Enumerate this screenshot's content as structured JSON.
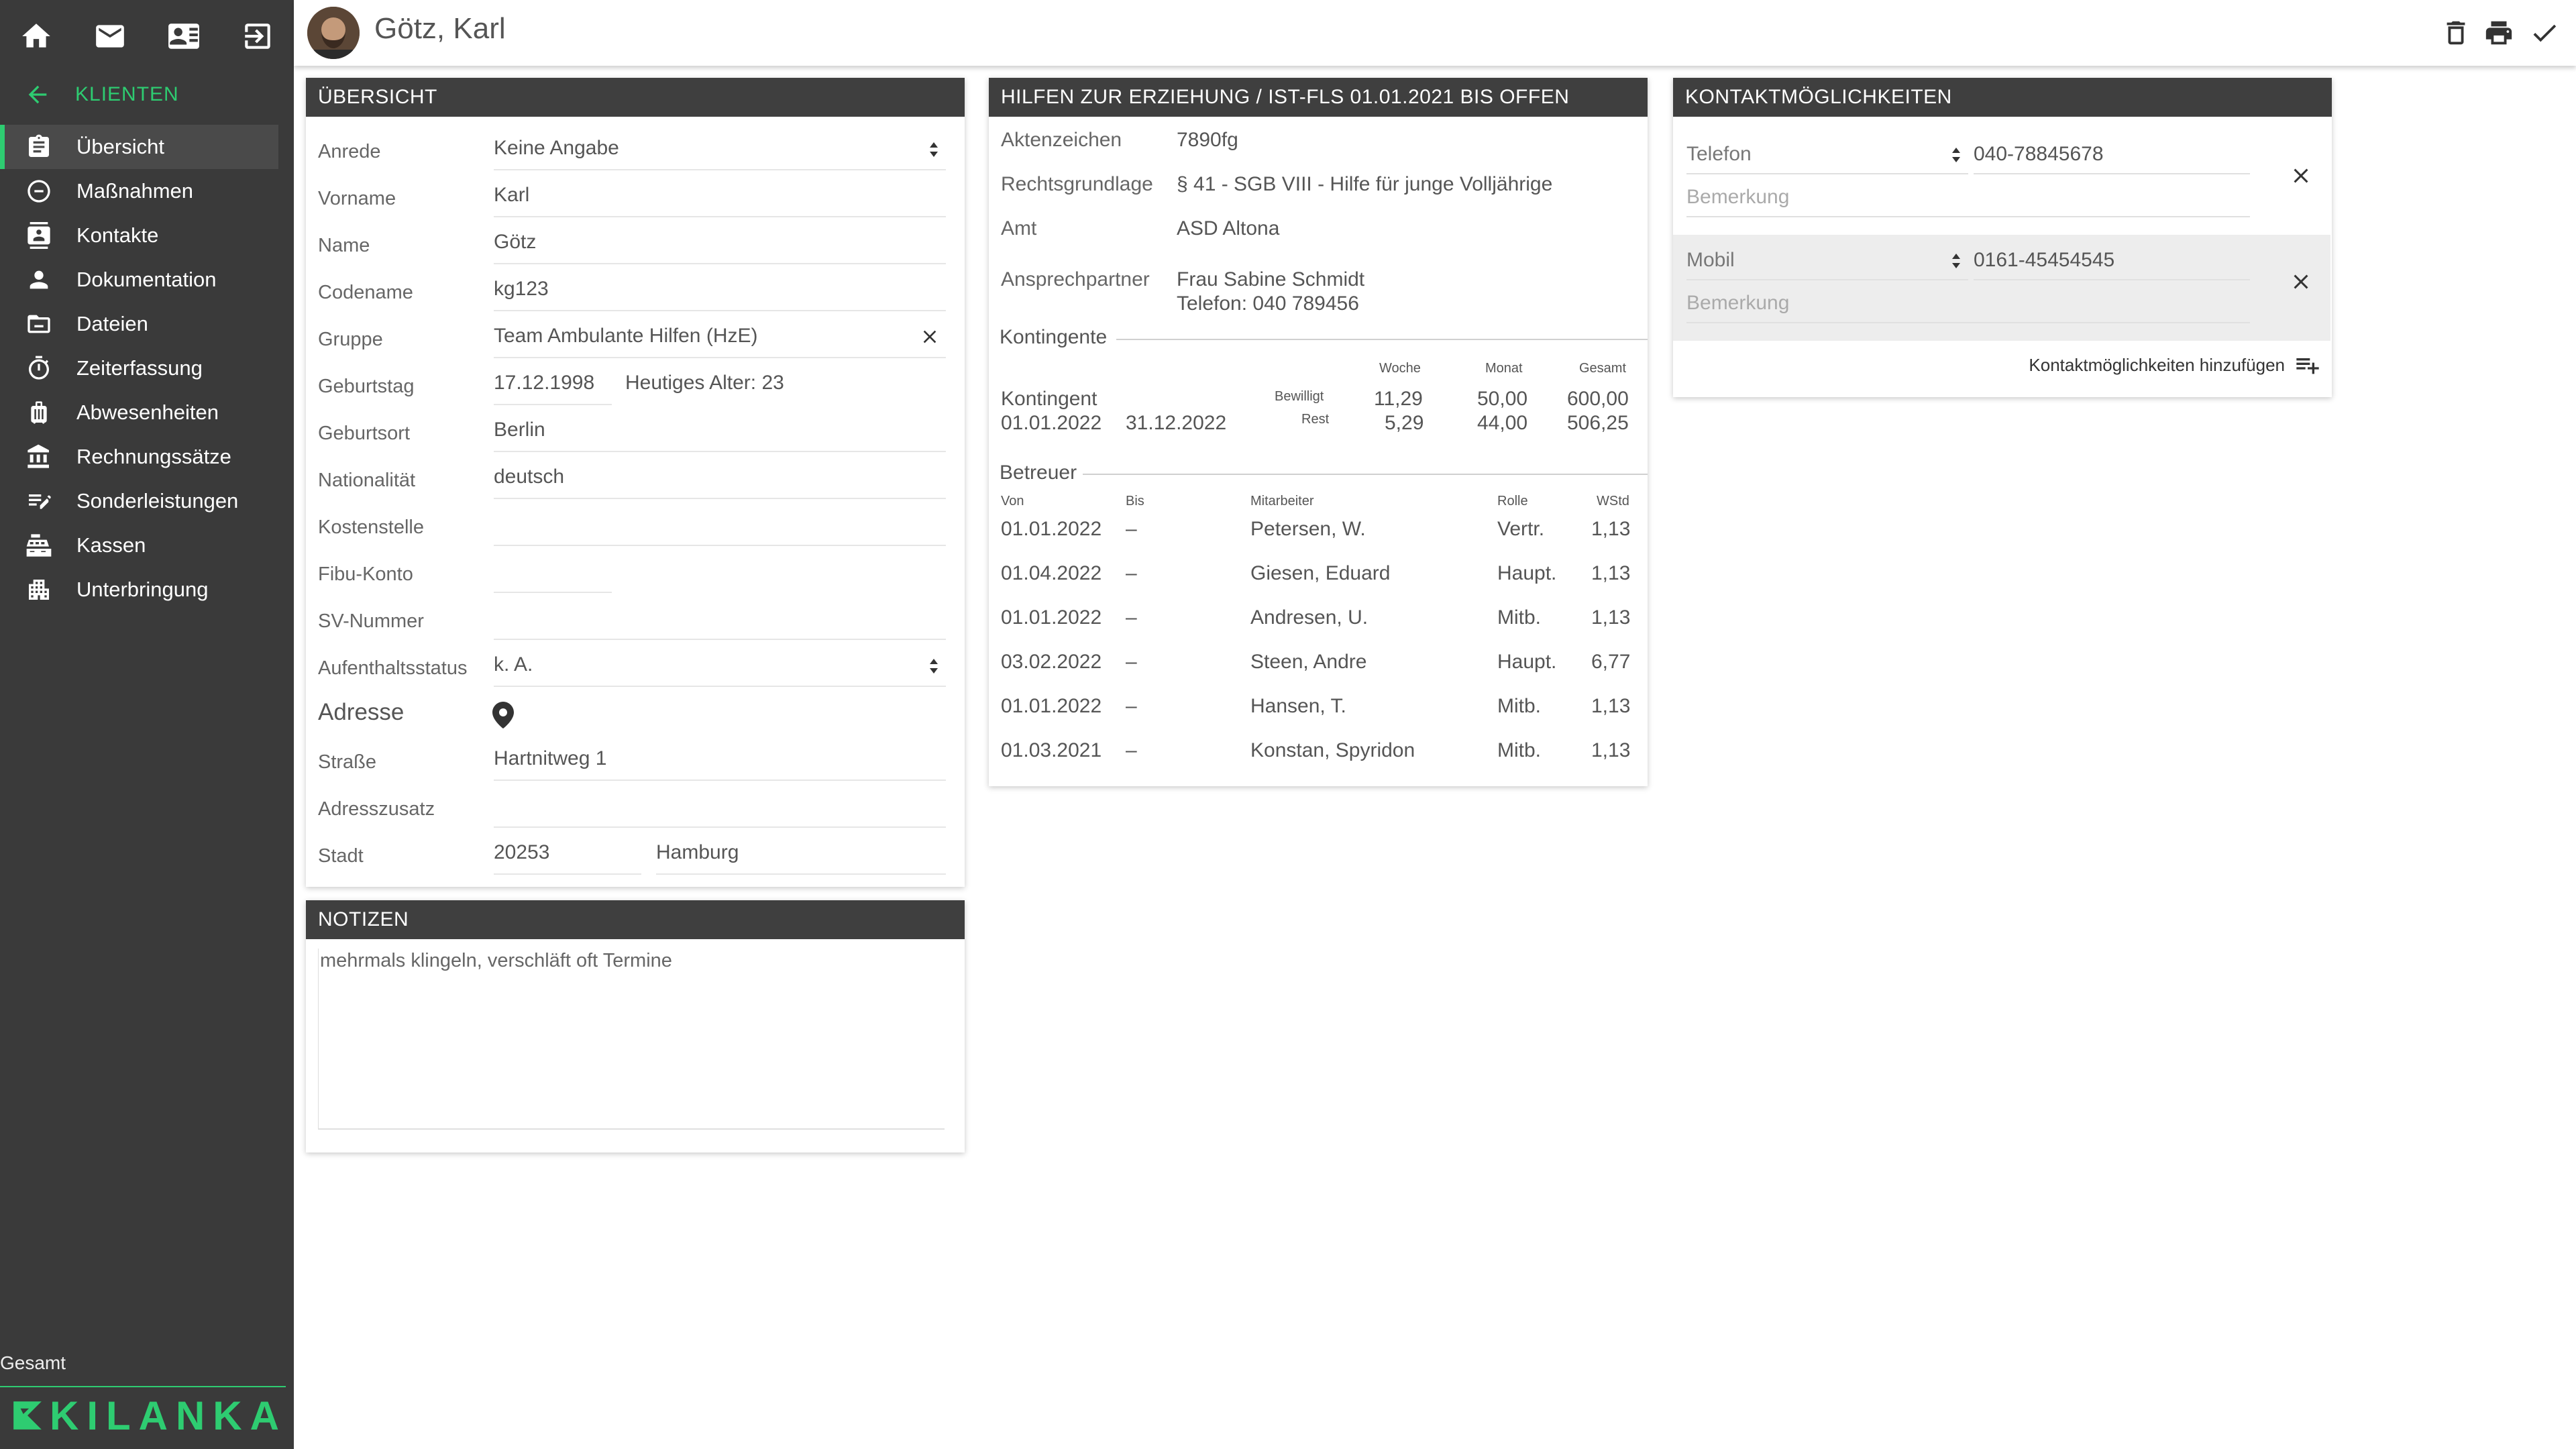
{
  "app": {
    "brand": "KILANKA"
  },
  "colors": {
    "accent": "#2ecc71",
    "sidebar": "#3a3a3a",
    "header": "#3f3f3f"
  },
  "sidebar": {
    "top_icons": [
      "home-icon",
      "mail-icon",
      "contact-card-icon",
      "logout-icon"
    ],
    "back_label": "KLIENTEN",
    "items": [
      {
        "label": "Übersicht",
        "icon": "overview-icon",
        "active": true
      },
      {
        "label": "Maßnahmen",
        "icon": "measures-icon"
      },
      {
        "label": "Kontakte",
        "icon": "contacts-icon"
      },
      {
        "label": "Dokumentation",
        "icon": "person-icon"
      },
      {
        "label": "Dateien",
        "icon": "folder-icon"
      },
      {
        "label": "Zeiterfassung",
        "icon": "stopwatch-icon"
      },
      {
        "label": "Abwesenheiten",
        "icon": "suitcase-icon"
      },
      {
        "label": "Rechnungssätze",
        "icon": "bank-icon"
      },
      {
        "label": "Sonderleistungen",
        "icon": "edit-list-icon"
      },
      {
        "label": "Kassen",
        "icon": "cash-register-icon"
      },
      {
        "label": "Unterbringung",
        "icon": "housing-icon"
      }
    ],
    "footer_label": "Gesamt"
  },
  "header": {
    "client_name": "Götz, Karl",
    "actions": [
      "delete-icon",
      "print-icon",
      "check-icon"
    ]
  },
  "overview": {
    "title": "ÜBERSICHT",
    "anrede": {
      "label": "Anrede",
      "value": "Keine Angabe"
    },
    "vorname": {
      "label": "Vorname",
      "value": "Karl"
    },
    "name": {
      "label": "Name",
      "value": "Götz"
    },
    "codename": {
      "label": "Codename",
      "value": "kg123"
    },
    "gruppe": {
      "label": "Gruppe",
      "value": "Team Ambulante Hilfen (HzE)"
    },
    "geburtstag": {
      "label": "Geburtstag",
      "value": "17.12.1998",
      "age": "Heutiges Alter: 23"
    },
    "geburtsort": {
      "label": "Geburtsort",
      "value": "Berlin"
    },
    "nationalitaet": {
      "label": "Nationalität",
      "value": "deutsch"
    },
    "kostenstelle": {
      "label": "Kostenstelle",
      "value": ""
    },
    "fibu": {
      "label": "Fibu-Konto",
      "value": ""
    },
    "sv": {
      "label": "SV-Nummer",
      "value": ""
    },
    "aufenthalt": {
      "label": "Aufenthaltsstatus",
      "value": "k. A."
    },
    "adresse_label": "Adresse",
    "strasse": {
      "label": "Straße",
      "value": "Hartnitweg 1"
    },
    "adresszusatz": {
      "label": "Adresszusatz",
      "value": ""
    },
    "stadt": {
      "label": "Stadt",
      "plz": "20253",
      "city": "Hamburg"
    }
  },
  "notes": {
    "title": "NOTIZEN",
    "text": "mehrmals klingeln, verschläft oft Termine"
  },
  "hilfen": {
    "title": "HILFEN ZUR ERZIEHUNG / IST-FLS 01.01.2021 BIS OFFEN",
    "aktenzeichen": {
      "label": "Aktenzeichen",
      "value": "7890fg"
    },
    "rechtsgrundlage": {
      "label": "Rechtsgrundlage",
      "value": "§ 41 - SGB VIII - Hilfe für junge Volljährige"
    },
    "amt": {
      "label": "Amt",
      "value": "ASD Altona"
    },
    "ansprechpartner": {
      "label": "Ansprechpartner",
      "name": "Frau Sabine Schmidt",
      "phone": "Telefon: 040 789456"
    },
    "kontingente": {
      "title": "Kontingente",
      "col_woche": "Woche",
      "col_monat": "Monat",
      "col_gesamt": "Gesamt",
      "label": "Kontingent",
      "from": "01.01.2022",
      "to": "31.12.2022",
      "bewilligt_label": "Bewilligt",
      "rest_label": "Rest",
      "bewilligt": {
        "woche": "11,29",
        "monat": "50,00",
        "gesamt": "600,00"
      },
      "rest": {
        "woche": "5,29",
        "monat": "44,00",
        "gesamt": "506,25"
      }
    },
    "betreuer": {
      "title": "Betreuer",
      "headers": {
        "von": "Von",
        "bis": "Bis",
        "mitarbeiter": "Mitarbeiter",
        "rolle": "Rolle",
        "wstd": "WStd"
      },
      "rows": [
        {
          "von": "01.01.2022",
          "bis": "–",
          "mitarbeiter": "Petersen, W.",
          "rolle": "Vertr.",
          "wstd": "1,13"
        },
        {
          "von": "01.04.2022",
          "bis": "–",
          "mitarbeiter": "Giesen, Eduard",
          "rolle": "Haupt.",
          "wstd": "1,13"
        },
        {
          "von": "01.01.2022",
          "bis": "–",
          "mitarbeiter": "Andresen, U.",
          "rolle": "Mitb.",
          "wstd": "1,13"
        },
        {
          "von": "03.02.2022",
          "bis": "–",
          "mitarbeiter": "Steen, Andre",
          "rolle": "Haupt.",
          "wstd": "6,77"
        },
        {
          "von": "01.01.2022",
          "bis": "–",
          "mitarbeiter": "Hansen, T.",
          "rolle": "Mitb.",
          "wstd": "1,13"
        },
        {
          "von": "01.03.2021",
          "bis": "–",
          "mitarbeiter": "Konstan, Spyridon",
          "rolle": "Mitb.",
          "wstd": "1,13"
        }
      ]
    }
  },
  "kontakt": {
    "title": "KONTAKTMÖGLICHKEITEN",
    "entries": [
      {
        "type": "Telefon",
        "value": "040-78845678",
        "remark_placeholder": "Bemerkung"
      },
      {
        "type": "Mobil",
        "value": "0161-45454545",
        "remark_placeholder": "Bemerkung"
      }
    ],
    "add_label": "Kontaktmöglichkeiten hinzufügen"
  }
}
